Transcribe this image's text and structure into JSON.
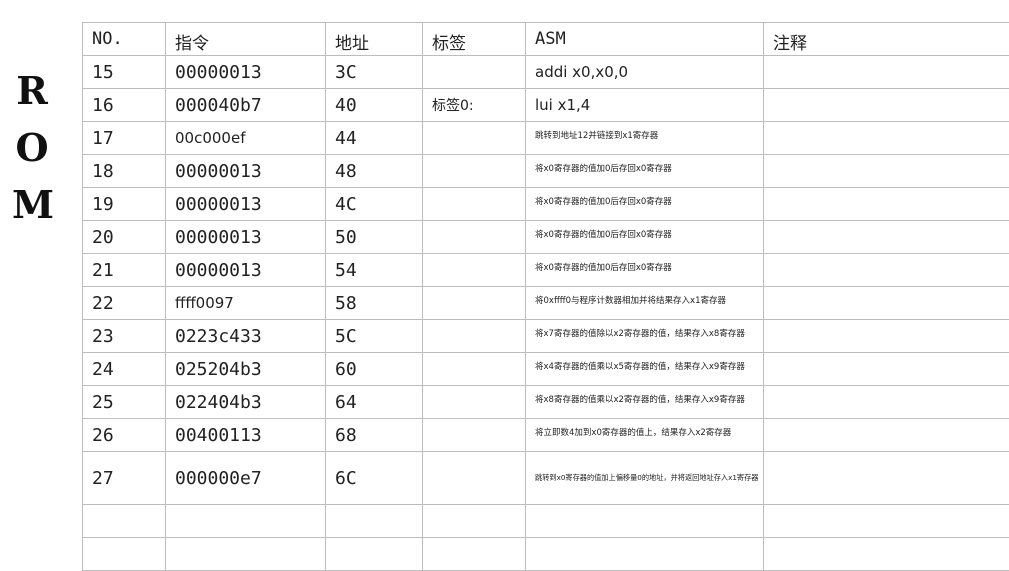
{
  "title_letters": [
    "R",
    "O",
    "M"
  ],
  "headers": {
    "no": "NO.",
    "instr": "指令",
    "addr": "地址",
    "label": "标签",
    "asm": "ASM",
    "comment": "注释"
  },
  "rows": [
    {
      "no": "15",
      "instr": "00000013",
      "addr": "3C",
      "label": "",
      "asm": "addi x0,x0,0",
      "comment": ""
    },
    {
      "no": "16",
      "instr": "000040b7",
      "addr": "40",
      "label": "标签0:",
      "asm": "lui x1,4",
      "comment": ""
    },
    {
      "no": "17",
      "instr": "00c000ef",
      "addr": "44",
      "label": "",
      "asm": "跳转到地址12并链接到x1寄存器",
      "comment": ""
    },
    {
      "no": "18",
      "instr": "00000013",
      "addr": "48",
      "label": "",
      "asm": "将x0寄存器的值加0后存回x0寄存器",
      "comment": ""
    },
    {
      "no": "19",
      "instr": "00000013",
      "addr": "4C",
      "label": "",
      "asm": "将x0寄存器的值加0后存回x0寄存器",
      "comment": ""
    },
    {
      "no": "20",
      "instr": "00000013",
      "addr": "50",
      "label": "",
      "asm": "将x0寄存器的值加0后存回x0寄存器",
      "comment": ""
    },
    {
      "no": "21",
      "instr": "00000013",
      "addr": "54",
      "label": "",
      "asm": "将x0寄存器的值加0后存回x0寄存器",
      "comment": ""
    },
    {
      "no": "22",
      "instr": "ffff0097",
      "addr": "58",
      "label": "",
      "asm": "将0xffff0与程序计数器相加并将结果存入x1寄存器",
      "comment": ""
    },
    {
      "no": "23",
      "instr": "0223c433",
      "addr": "5C",
      "label": "",
      "asm": "将x7寄存器的值除以x2寄存器的值，结果存入x8寄存器",
      "comment": ""
    },
    {
      "no": "24",
      "instr": "025204b3",
      "addr": "60",
      "label": "",
      "asm": "将x4寄存器的值乘以x5寄存器的值，结果存入x9寄存器",
      "comment": ""
    },
    {
      "no": "25",
      "instr": "022404b3",
      "addr": "64",
      "label": "",
      "asm": "将x8寄存器的值乘以x2寄存器的值，结果存入x9寄存器",
      "comment": ""
    },
    {
      "no": "26",
      "instr": "00400113",
      "addr": "68",
      "label": "",
      "asm": "将立即数4加到x0寄存器的值上，结果存入x2寄存器",
      "comment": ""
    },
    {
      "no": "27",
      "instr": "000000e7",
      "addr": "6C",
      "label": "",
      "asm": "跳转到x0寄存器的值加上偏移量0的地址，并将返回地址存入x1寄存器",
      "comment": ""
    }
  ]
}
